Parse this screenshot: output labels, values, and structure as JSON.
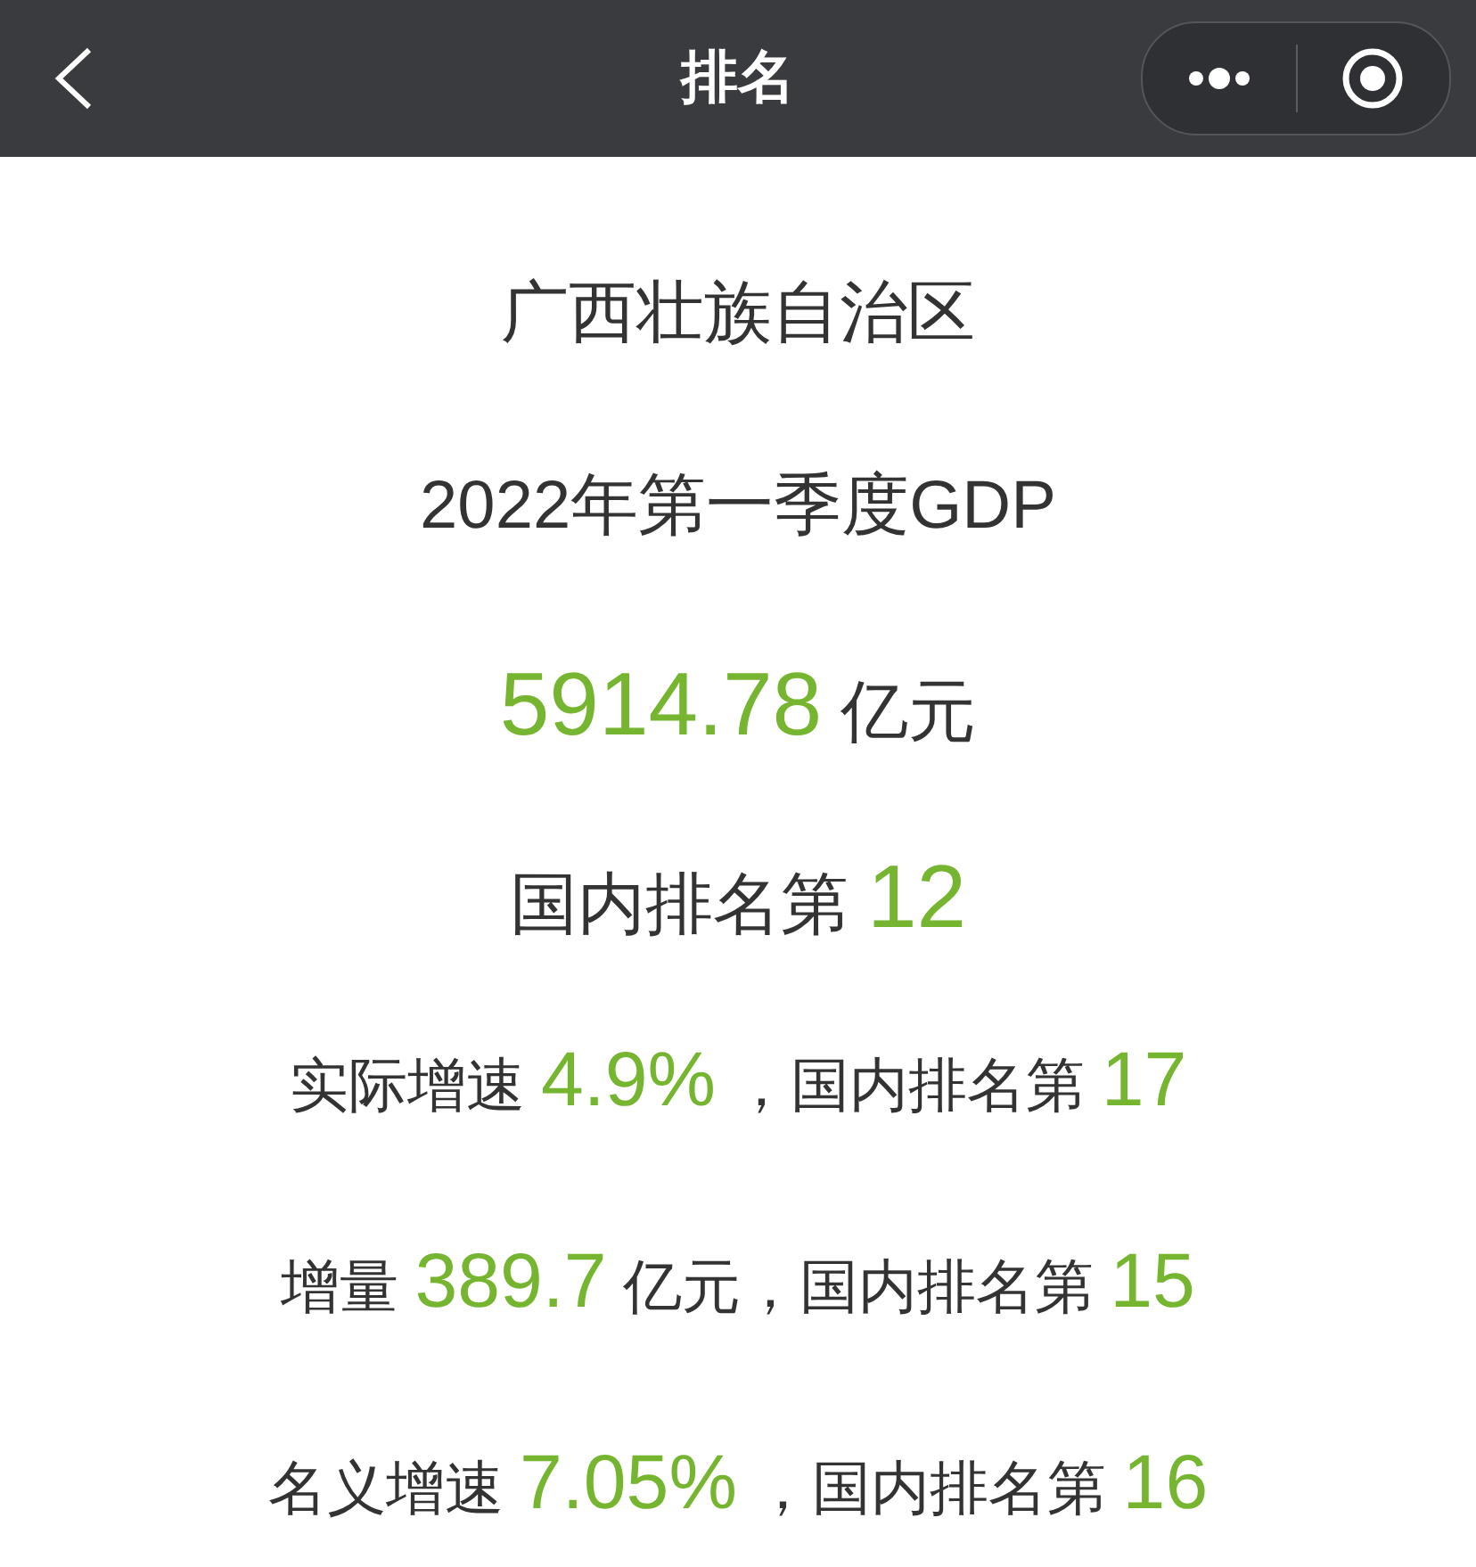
{
  "header": {
    "title": "排名"
  },
  "lines": [
    {
      "kind": "large",
      "segments": [
        {
          "kind": "plain",
          "text": "广西壮族自治区"
        }
      ]
    },
    {
      "kind": "large",
      "segments": [
        {
          "kind": "plain",
          "text": "2022年第一季度GDP"
        }
      ]
    },
    {
      "kind": "large",
      "segments": [
        {
          "kind": "value",
          "text": "5914.78"
        },
        {
          "kind": "plain",
          "text": " 亿元"
        }
      ]
    },
    {
      "kind": "large",
      "segments": [
        {
          "kind": "plain",
          "text": "国内排名第 "
        },
        {
          "kind": "value",
          "text": "12"
        }
      ]
    },
    {
      "kind": "small",
      "segments": [
        {
          "kind": "plain",
          "text": "实际增速 "
        },
        {
          "kind": "value",
          "text": "4.9%"
        },
        {
          "kind": "plain",
          "text": " ，国内排名第 "
        },
        {
          "kind": "value",
          "text": "17"
        }
      ]
    },
    {
      "kind": "small",
      "segments": [
        {
          "kind": "plain",
          "text": "增量 "
        },
        {
          "kind": "value",
          "text": "389.7"
        },
        {
          "kind": "plain",
          "text": " 亿元，国内排名第 "
        },
        {
          "kind": "value",
          "text": "15"
        }
      ]
    },
    {
      "kind": "small",
      "segments": [
        {
          "kind": "plain",
          "text": "名义增速 "
        },
        {
          "kind": "value",
          "text": "7.05%"
        },
        {
          "kind": "plain",
          "text": " ，国内排名第 "
        },
        {
          "kind": "value",
          "text": "16"
        }
      ]
    }
  ]
}
